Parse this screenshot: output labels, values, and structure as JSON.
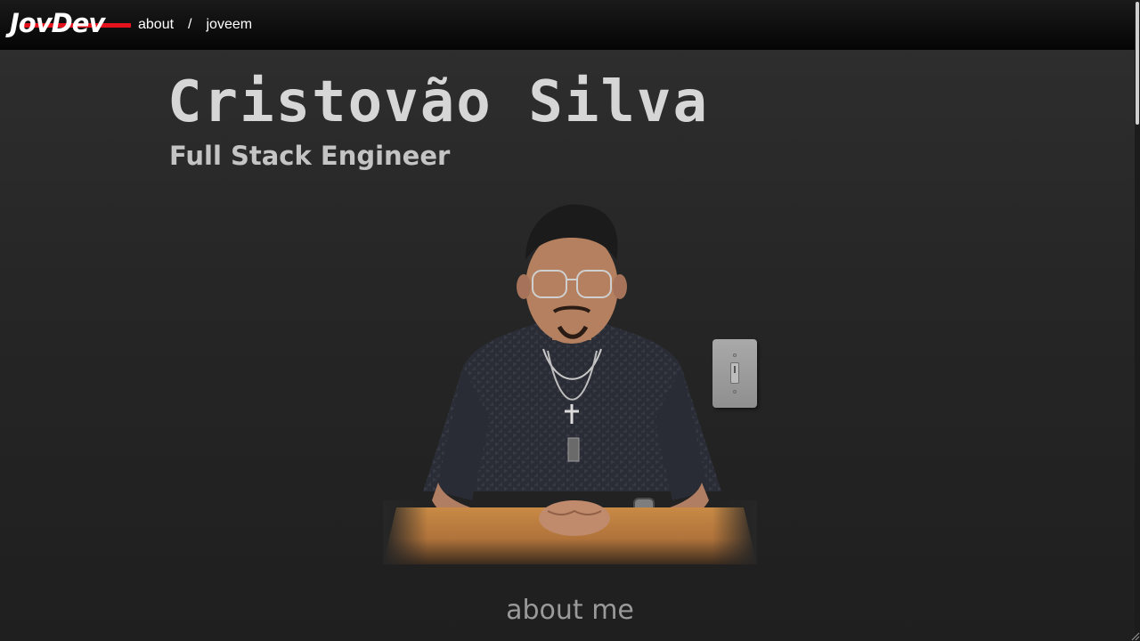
{
  "header": {
    "logo_text": "JovDev",
    "breadcrumb": [
      {
        "label": "about"
      },
      {
        "separator": "/"
      },
      {
        "label": "joveem"
      }
    ]
  },
  "hero": {
    "name": "Cristovão Silva",
    "role": "Full Stack Engineer"
  },
  "theme_switch": {
    "icon": "light-switch-icon",
    "state": "on"
  },
  "sections": {
    "about_heading": "about me"
  },
  "colors": {
    "background": "#262626",
    "topbar": "#0a0a0a",
    "logo_accent": "#e3121d",
    "name_text": "#d6d6d6",
    "heading_text": "#9a9a9a"
  }
}
